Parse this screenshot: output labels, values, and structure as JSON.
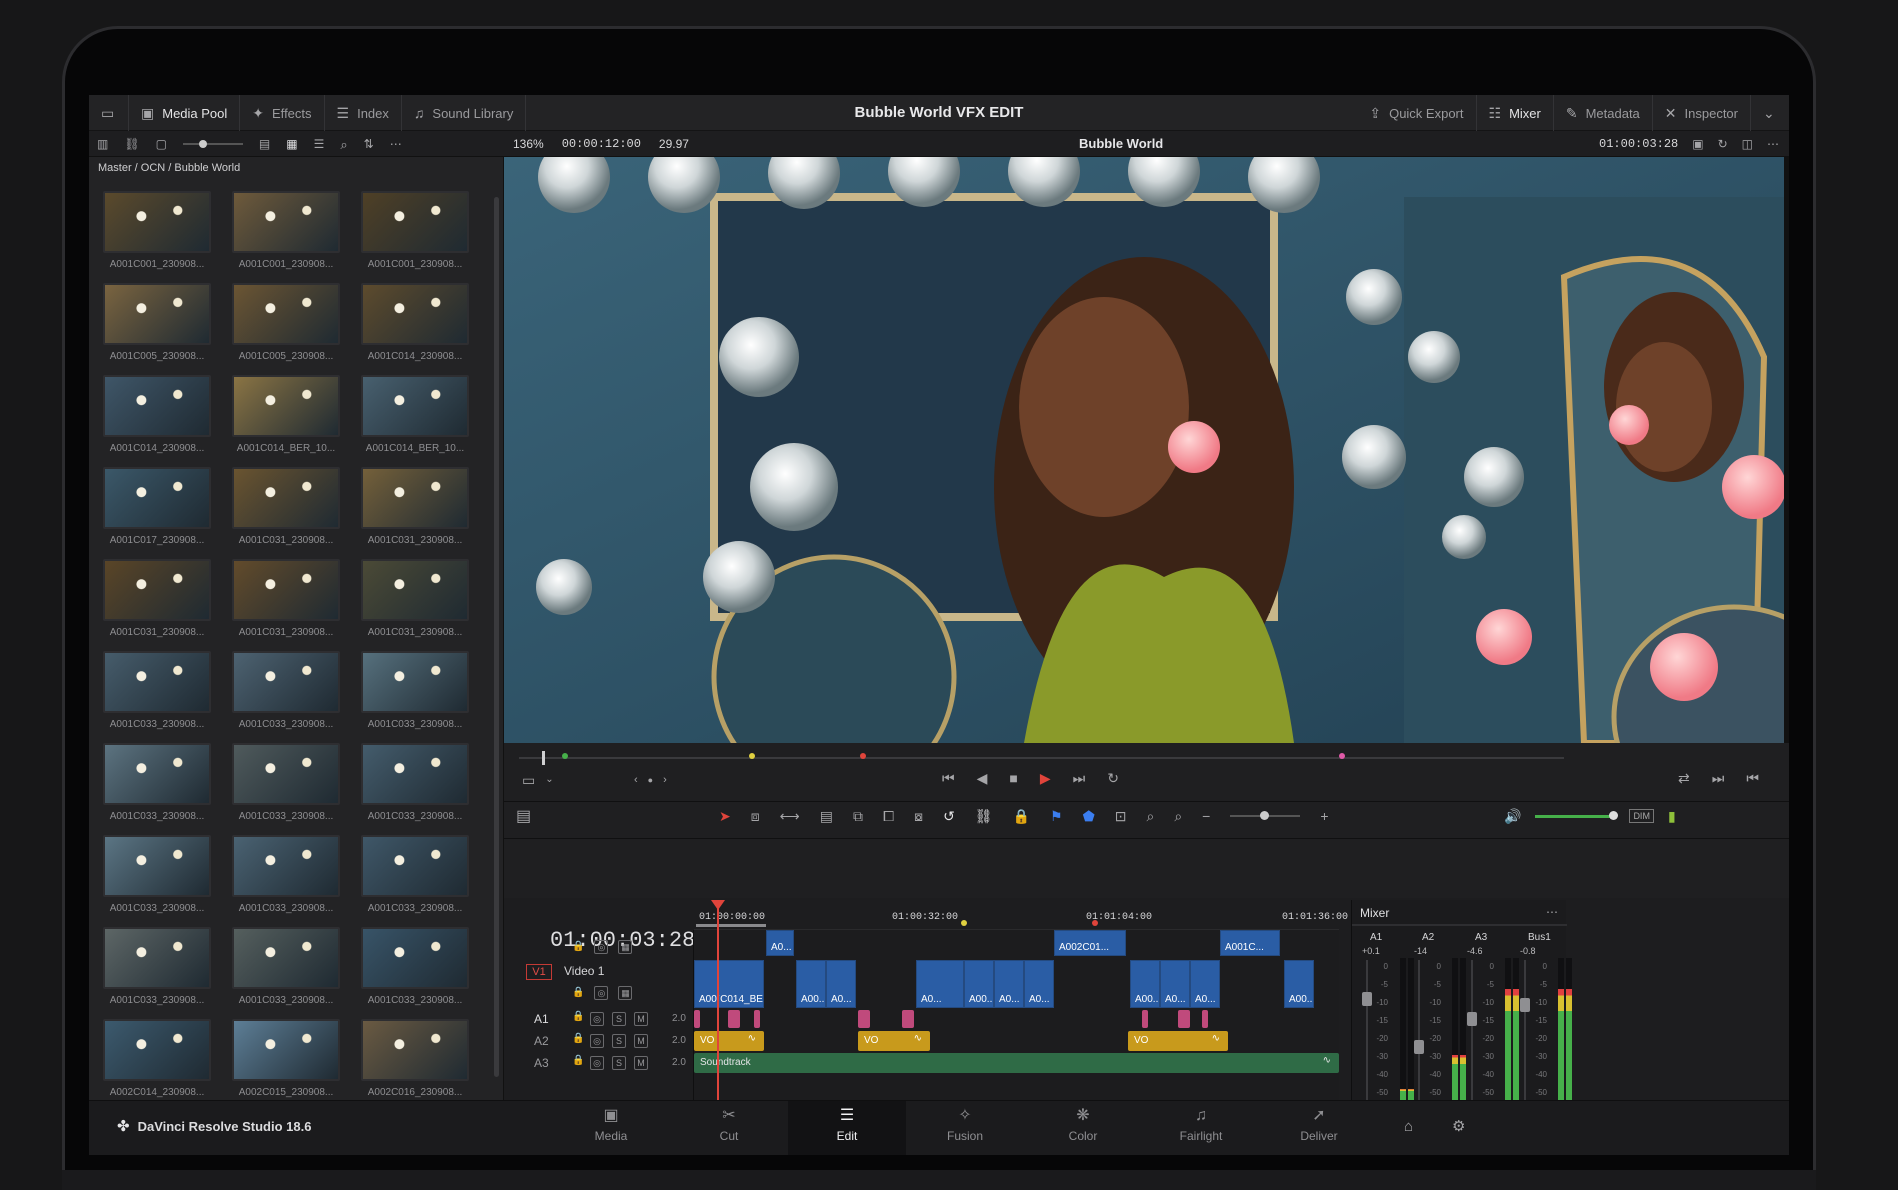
{
  "app": {
    "title": "Bubble World VFX EDIT",
    "brand": "DaVinci Resolve Studio 18.6"
  },
  "toolbar": {
    "left": [
      {
        "label": "Media Pool",
        "icon": "media-pool-icon"
      },
      {
        "label": "Effects",
        "icon": "effects-icon"
      },
      {
        "label": "Index",
        "icon": "index-icon"
      },
      {
        "label": "Sound Library",
        "icon": "sound-library-icon"
      }
    ],
    "right": [
      {
        "label": "Quick Export",
        "icon": "export-icon"
      },
      {
        "label": "Mixer",
        "icon": "mixer-icon"
      },
      {
        "label": "Metadata",
        "icon": "metadata-icon"
      },
      {
        "label": "Inspector",
        "icon": "inspector-icon"
      }
    ]
  },
  "viewer_bar": {
    "zoom": "136%",
    "duration": "00:00:12:00",
    "fps": "29.97",
    "timeline_name": "Bubble World",
    "timecode": "01:00:03:28"
  },
  "media_pool": {
    "breadcrumb": "Master / OCN / Bubble World",
    "clips": [
      {
        "name": "A001C001_230908...",
        "tone": "#5b4a2c"
      },
      {
        "name": "A001C001_230908...",
        "tone": "#6e5a3b"
      },
      {
        "name": "A001C001_230908...",
        "tone": "#4f4026"
      },
      {
        "name": "A001C005_230908...",
        "tone": "#7a6440"
      },
      {
        "name": "A001C005_230908...",
        "tone": "#6b5533"
      },
      {
        "name": "A001C014_230908...",
        "tone": "#5d4b2d"
      },
      {
        "name": "A001C014_230908...",
        "tone": "#3f5668"
      },
      {
        "name": "A001C014_BER_10...",
        "tone": "#8a7444"
      },
      {
        "name": "A001C014_BER_10...",
        "tone": "#48606f"
      },
      {
        "name": "A001C017_230908...",
        "tone": "#3b5869"
      },
      {
        "name": "A001C031_230908...",
        "tone": "#6a5430"
      },
      {
        "name": "A001C031_230908...",
        "tone": "#74603a"
      },
      {
        "name": "A001C031_230908...",
        "tone": "#5a4527"
      },
      {
        "name": "A001C031_230908...",
        "tone": "#624b2b"
      },
      {
        "name": "A001C031_230908...",
        "tone": "#4b4a36"
      },
      {
        "name": "A001C033_230908...",
        "tone": "#465c6b"
      },
      {
        "name": "A001C033_230908...",
        "tone": "#4d6271"
      },
      {
        "name": "A001C033_230908...",
        "tone": "#56707d"
      },
      {
        "name": "A001C033_230908...",
        "tone": "#5c7380"
      },
      {
        "name": "A001C033_230908...",
        "tone": "#4f5a5c"
      },
      {
        "name": "A001C033_230908...",
        "tone": "#445c6c"
      },
      {
        "name": "A001C033_230908...",
        "tone": "#5b7584"
      },
      {
        "name": "A001C033_230908...",
        "tone": "#4a6272"
      },
      {
        "name": "A001C033_230908...",
        "tone": "#3f5768"
      },
      {
        "name": "A001C033_230908...",
        "tone": "#5d6666"
      },
      {
        "name": "A001C033_230908...",
        "tone": "#555f5e"
      },
      {
        "name": "A001C033_230908...",
        "tone": "#385468"
      },
      {
        "name": "A002C014_230908...",
        "tone": "#3c5a6e"
      },
      {
        "name": "A002C015_230908...",
        "tone": "#5d7e96"
      },
      {
        "name": "A002C016_230908...",
        "tone": "#6a5a42"
      }
    ]
  },
  "timeline": {
    "timecode": "01:00:03:28",
    "ruler": [
      "01:00:00:00",
      "01:00:32:00",
      "01:01:04:00",
      "01:01:36:00"
    ],
    "tracks": {
      "v1": {
        "id": "V1",
        "name": "Video 1"
      },
      "audio": [
        {
          "id": "A1",
          "level": "2.0"
        },
        {
          "id": "A2",
          "level": "2.0"
        },
        {
          "id": "A3",
          "level": "2.0"
        }
      ]
    },
    "upper_clips": [
      "A0...",
      "A002C01...",
      "A001C..."
    ],
    "video_clips": [
      "A00`C014_BE...",
      "A00...",
      "A0...",
      "A0...",
      "A00...",
      "A0...",
      "A0...",
      "A00...",
      "A0...",
      "A0...",
      "A00..."
    ],
    "audio_labels": {
      "vo1": "VO",
      "vo2": "VO",
      "vo3": "VO",
      "soundtrack": "Soundtrack"
    },
    "btn_s": "S",
    "btn_m": "M"
  },
  "mixer": {
    "title": "Mixer",
    "channels": [
      {
        "name": "A1",
        "db": "+0.1"
      },
      {
        "name": "A2",
        "db": "-14"
      },
      {
        "name": "A3",
        "db": "-4.6"
      },
      {
        "name": "Bus1",
        "db": "-0.8"
      }
    ],
    "scale": [
      "0",
      "-5",
      "-10",
      "-15",
      "-20",
      "-30",
      "-40",
      "-50"
    ]
  },
  "transport": {
    "dim": "DIM"
  },
  "pages": [
    {
      "label": "Media",
      "icon": "media-page-icon",
      "glyph": "▣"
    },
    {
      "label": "Cut",
      "icon": "cut-page-icon",
      "glyph": "✂"
    },
    {
      "label": "Edit",
      "icon": "edit-page-icon",
      "glyph": "☰"
    },
    {
      "label": "Fusion",
      "icon": "fusion-page-icon",
      "glyph": "✧"
    },
    {
      "label": "Color",
      "icon": "color-page-icon",
      "glyph": "❋"
    },
    {
      "label": "Fairlight",
      "icon": "fairlight-page-icon",
      "glyph": "♫"
    },
    {
      "label": "Deliver",
      "icon": "deliver-page-icon",
      "glyph": "➚"
    }
  ],
  "colors": {
    "accent": "#e0443b",
    "video_clip": "#2a5da5",
    "vo_clip": "#c89a1c",
    "soundtrack": "#2f6b46",
    "a1_marker": "#c04a7c"
  }
}
